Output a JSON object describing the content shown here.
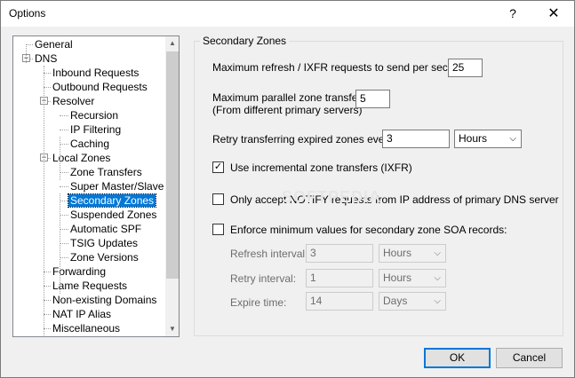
{
  "window": {
    "title": "Options",
    "help_label": "?",
    "close_label": "✕"
  },
  "tree": [
    {
      "label": "General",
      "level": 0,
      "expander": ""
    },
    {
      "label": "DNS",
      "level": 0,
      "expander": "−"
    },
    {
      "label": "Inbound Requests",
      "level": 1,
      "expander": ""
    },
    {
      "label": "Outbound Requests",
      "level": 1,
      "expander": ""
    },
    {
      "label": "Resolver",
      "level": 1,
      "expander": "−"
    },
    {
      "label": "Recursion",
      "level": 2,
      "expander": ""
    },
    {
      "label": "IP Filtering",
      "level": 2,
      "expander": ""
    },
    {
      "label": "Caching",
      "level": 2,
      "expander": ""
    },
    {
      "label": "Local Zones",
      "level": 1,
      "expander": "−"
    },
    {
      "label": "Zone Transfers",
      "level": 2,
      "expander": ""
    },
    {
      "label": "Super Master/Slave",
      "level": 2,
      "expander": ""
    },
    {
      "label": "Secondary Zones",
      "level": 2,
      "expander": "",
      "selected": true
    },
    {
      "label": "Suspended Zones",
      "level": 2,
      "expander": ""
    },
    {
      "label": "Automatic SPF",
      "level": 2,
      "expander": ""
    },
    {
      "label": "TSIG Updates",
      "level": 2,
      "expander": ""
    },
    {
      "label": "Zone Versions",
      "level": 2,
      "expander": ""
    },
    {
      "label": "Forwarding",
      "level": 1,
      "expander": ""
    },
    {
      "label": "Lame Requests",
      "level": 1,
      "expander": ""
    },
    {
      "label": "Non-existing Domains",
      "level": 1,
      "expander": ""
    },
    {
      "label": "NAT IP Alias",
      "level": 1,
      "expander": ""
    },
    {
      "label": "Miscellaneous",
      "level": 1,
      "expander": ""
    }
  ],
  "panel": {
    "group_title": "Secondary Zones",
    "max_refresh_label": "Maximum refresh / IXFR requests to send per second:",
    "max_refresh_value": "25",
    "max_parallel_label": "Maximum parallel zone transfers:",
    "max_parallel_sublabel": "(From different primary servers)",
    "max_parallel_value": "5",
    "retry_label": "Retry transferring expired zones every:",
    "retry_value": "3",
    "retry_unit": "Hours",
    "ixfr_label": "Use incremental zone transfers (IXFR)",
    "ixfr_checked": true,
    "notify_label": "Only accept NOTIFY requests from IP address of primary DNS server",
    "notify_checked": false,
    "enforce_label": "Enforce minimum values for secondary zone SOA records:",
    "enforce_checked": false,
    "refresh_label": "Refresh interval:",
    "refresh_value": "3",
    "refresh_unit": "Hours",
    "retry_interval_label": "Retry interval:",
    "retry_interval_value": "1",
    "retry_interval_unit": "Hours",
    "expire_label": "Expire time:",
    "expire_value": "14",
    "expire_unit": "Days"
  },
  "footer": {
    "ok_label": "OK",
    "cancel_label": "Cancel"
  },
  "watermark": "SOFTPEDIA"
}
